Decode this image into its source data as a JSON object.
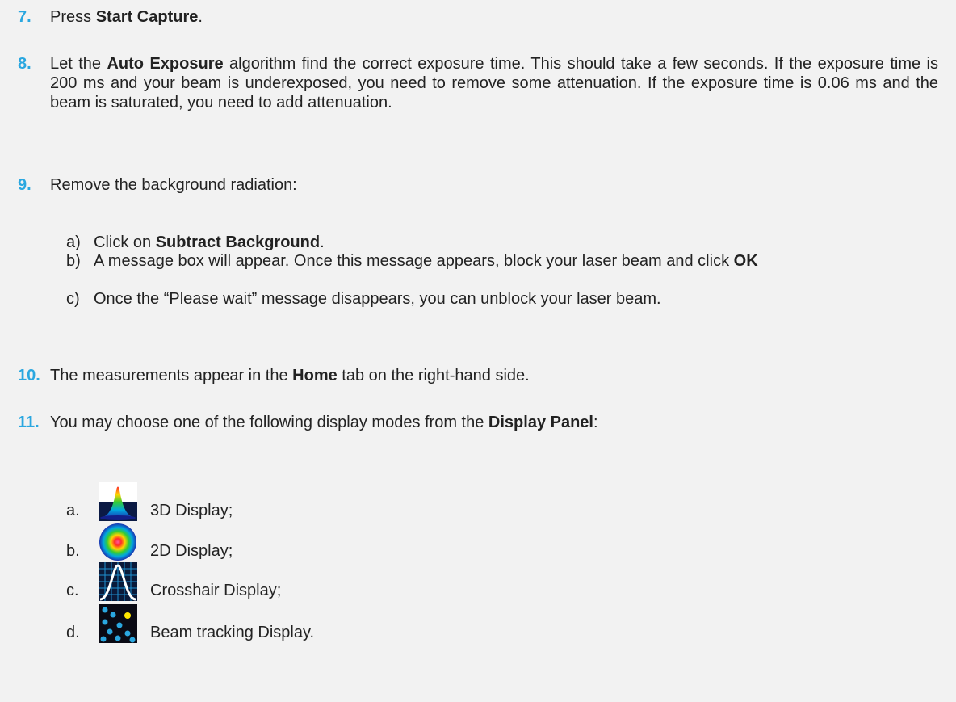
{
  "steps": [
    {
      "num": "7.",
      "pre": "Press ",
      "bold": "Start Capture",
      "post": "."
    },
    {
      "num": "8.",
      "pre": "Let the ",
      "bold": "Auto Exposure",
      "post": " algorithm find the correct exposure time. This should take a few seconds. If the exposure time is 200 ms and your beam is underexposed, you need to remove some attenuation. If the exposure time is 0.06 ms and the beam is saturated, you need to add attenuation."
    },
    {
      "num": "9.",
      "text": "Remove the background radiation:"
    },
    {
      "num": "10.",
      "pre": "The measurements appear in the ",
      "bold": "Home",
      "post": " tab on the right-hand side."
    },
    {
      "num": "11.",
      "pre": "You may choose one of the following display modes from the ",
      "bold": "Display Panel",
      "post": ":"
    }
  ],
  "substeps": [
    {
      "letter": "a)",
      "pre": "Click on ",
      "bold": "Subtract Background",
      "post": "."
    },
    {
      "letter": "b)",
      "pre": "A message box will appear. Once this message appears, block your laser beam and click ",
      "bold": "OK",
      "post": ""
    },
    {
      "letter": "c)",
      "pre": "Once the “Please wait” message disappears, you can unblock your laser beam.",
      "bold": "",
      "post": ""
    }
  ],
  "modes": [
    {
      "letter": "a.",
      "label": "3D Display;",
      "icon": "3d-display-icon"
    },
    {
      "letter": "b.",
      "label": "2D Display;",
      "icon": "2d-display-icon"
    },
    {
      "letter": "c.",
      "label": "Crosshair Display;",
      "icon": "crosshair-display-icon"
    },
    {
      "letter": "d.",
      "label": "Beam tracking Display.",
      "icon": "beam-tracking-display-icon"
    }
  ]
}
